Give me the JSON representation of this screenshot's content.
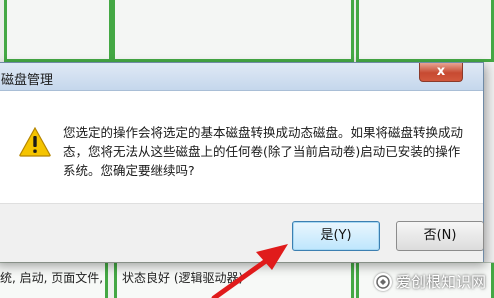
{
  "background": {
    "status_left": "统, 启动, 页面文件,",
    "status_mid": "状态良好 (逻辑驱动器)"
  },
  "dialog": {
    "title": "磁盘管理",
    "close_label": "x",
    "message": "您选定的操作会将选定的基本磁盘转换成动态磁盘。如果将磁盘转换成动态，您将无法从这些磁盘上的任何卷(除了当前启动卷)启动已安装的操作系统。您确定要继续吗?",
    "yes_label": "是(Y)",
    "no_label": "否(N)"
  },
  "watermark": {
    "text": "爱创根知识网"
  },
  "colors": {
    "dialog_bg": "#f0f0f0",
    "content_bg": "#ffffff",
    "titlebar": "#c5d7ec",
    "close_red": "#c74a31",
    "partition_green": "#44a844",
    "arrow_red": "#e01b1b",
    "warning_yellow": "#f5c400"
  }
}
